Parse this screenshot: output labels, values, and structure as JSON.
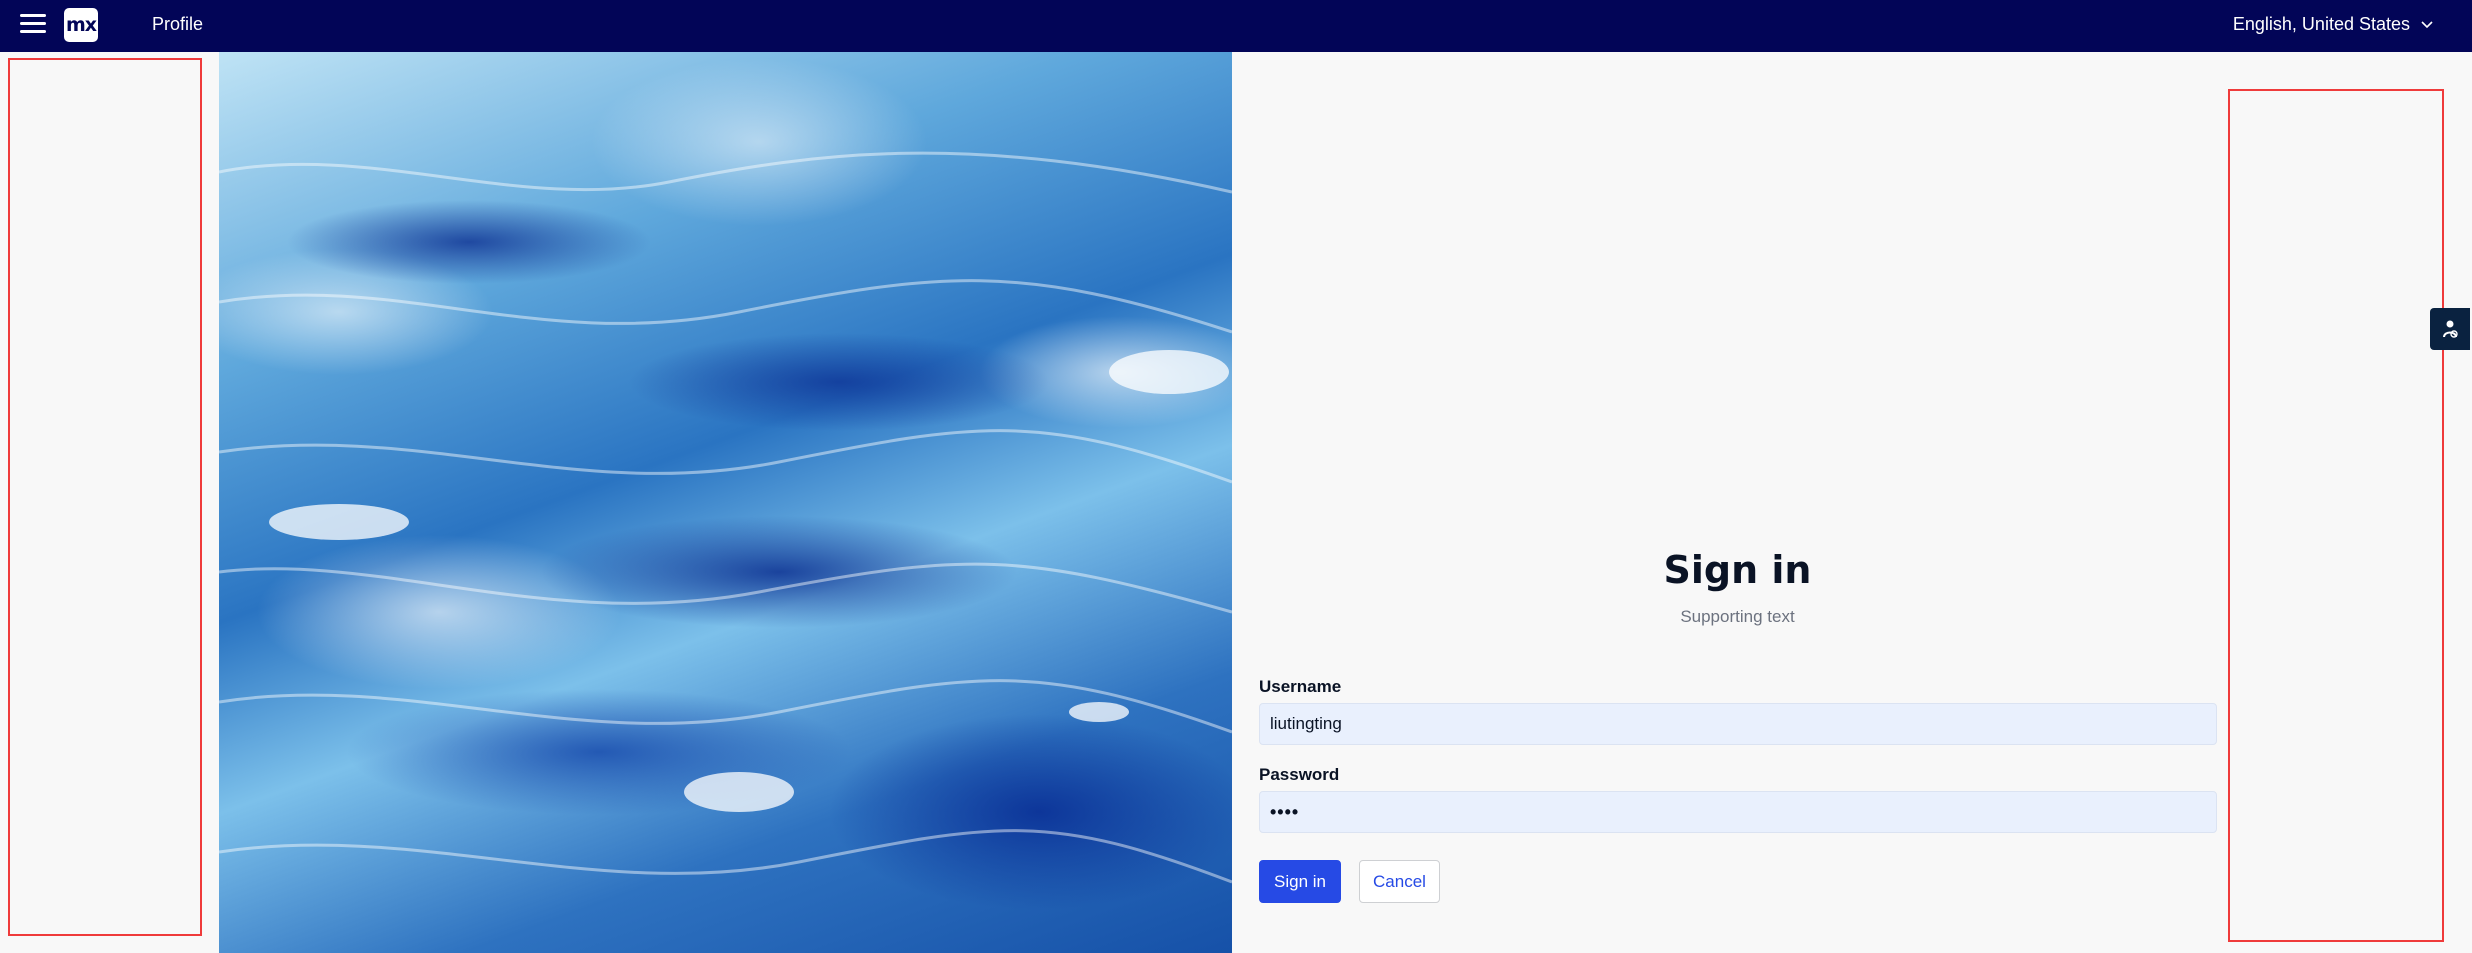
{
  "topbar": {
    "menu_icon": "hamburger-menu-icon",
    "logo_text": "mx",
    "nav_item": "Profile",
    "language": "English, United States",
    "language_icon": "chevron-down-icon",
    "background_color": "#020557"
  },
  "login": {
    "title": "Sign in",
    "subtitle": "Supporting text",
    "username_label": "Username",
    "username_value": "liutingting",
    "password_label": "Password",
    "password_value": "••••",
    "signin_button": "Sign in",
    "cancel_button": "Cancel",
    "accent_color": "#264ae5"
  },
  "side_tab": {
    "icon": "accessibility-person-icon"
  },
  "annotations": {
    "highlight_color": "#ef3b3b"
  }
}
